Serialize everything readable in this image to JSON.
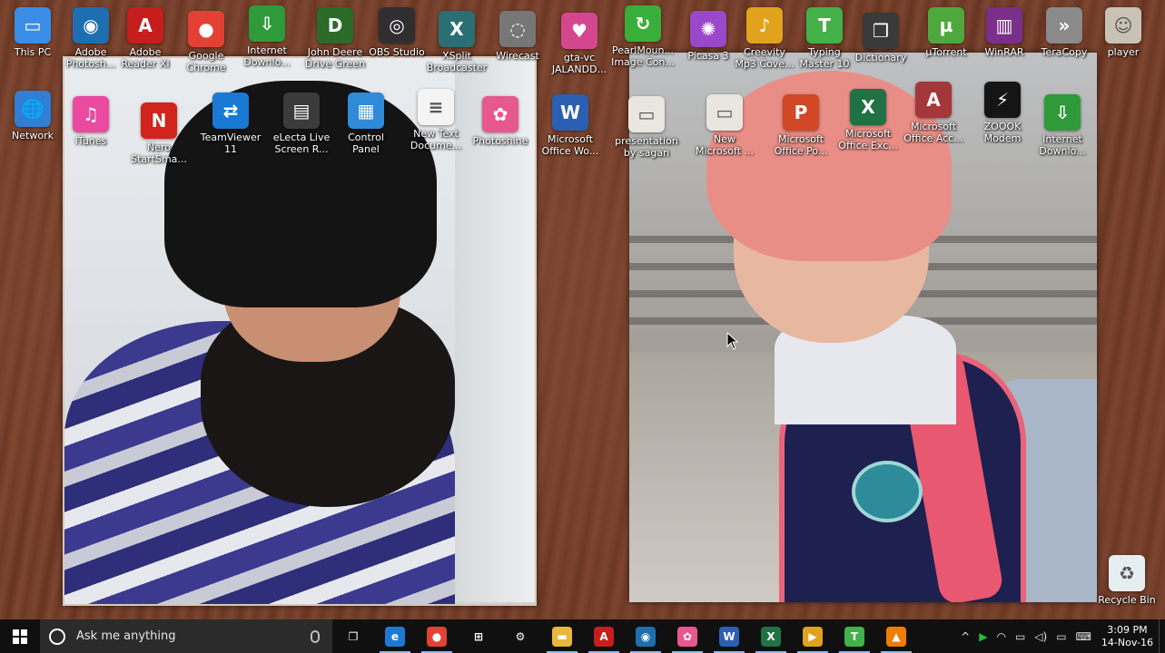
{
  "desktop": {
    "icons": [
      {
        "label": "This PC",
        "glyph": "▭",
        "color": "#3a8ee6",
        "icon": "computer-icon"
      },
      {
        "label": "Network",
        "glyph": "🌐",
        "color": "#2f7fd6",
        "icon": "network-icon"
      },
      {
        "label": "Adobe\nPhotosh...",
        "glyph": "◉",
        "color": "#1d6fb0",
        "icon": "adobe-photoshop-icon"
      },
      {
        "label": "iTunes",
        "glyph": "♫",
        "color": "#ea4aa0",
        "icon": "itunes-icon"
      },
      {
        "label": "Adobe\nReader XI",
        "glyph": "A",
        "color": "#c61d1d",
        "icon": "adobe-reader-icon"
      },
      {
        "label": "Nero\nStartSma...",
        "glyph": "N",
        "color": "#d2231d",
        "icon": "nero-icon"
      },
      {
        "label": "Google\nChrome",
        "glyph": "●",
        "color": "#e34133",
        "icon": "chrome-icon"
      },
      {
        "label": "TeamViewer\n11",
        "glyph": "⇄",
        "color": "#1979d4",
        "icon": "teamviewer-icon"
      },
      {
        "label": "Internet\nDownlo...",
        "glyph": "⇩",
        "color": "#2e9a3a",
        "icon": "idm-icon"
      },
      {
        "label": "eLecta Live\nScreen R...",
        "glyph": "▤",
        "color": "#3b3b3b",
        "icon": "electa-icon"
      },
      {
        "label": "John Deere\nDrive Green",
        "glyph": "D",
        "color": "#2a6b2a",
        "icon": "john-deere-icon"
      },
      {
        "label": "Control\nPanel",
        "glyph": "▦",
        "color": "#2f8ad8",
        "icon": "control-panel-icon"
      },
      {
        "label": "OBS Studio",
        "glyph": "◎",
        "color": "#302e31",
        "icon": "obs-icon"
      },
      {
        "label": "New Text\nDocume...",
        "glyph": "≡",
        "color": "#f4f4f4",
        "icon": "text-document-icon"
      },
      {
        "label": "XSplit\nBroadcaster",
        "glyph": "X",
        "color": "#2a6f73",
        "icon": "xsplit-icon"
      },
      {
        "label": "Photoshine",
        "glyph": "✿",
        "color": "#e6588f",
        "icon": "photoshine-icon"
      },
      {
        "label": "Wirecast",
        "glyph": "◌",
        "color": "#777777",
        "icon": "wirecast-icon"
      },
      {
        "label": "gta-vc\nJALANDD...",
        "glyph": "♥",
        "color": "#d4478f",
        "icon": "gta-icon"
      },
      {
        "label": "Microsoft\nOffice Wo...",
        "glyph": "W",
        "color": "#2b5fb3",
        "icon": "word-icon"
      },
      {
        "label": "PearlMoun...\nImage Con...",
        "glyph": "↻",
        "color": "#3aae3a",
        "icon": "pearlmountain-icon"
      },
      {
        "label": "presentation\nby sagan",
        "glyph": "▭",
        "color": "#e9e5df",
        "icon": "presentation-file-icon"
      },
      {
        "label": "Picasa 3",
        "glyph": "✺",
        "color": "#9a48c9",
        "icon": "picasa-icon"
      },
      {
        "label": "New\nMicrosoft ...",
        "glyph": "▭",
        "color": "#e9e5df",
        "icon": "new-presentation-icon"
      },
      {
        "label": "Creevity\nMp3 Cove...",
        "glyph": "♪",
        "color": "#e1a21d",
        "icon": "creevity-icon"
      },
      {
        "label": "Microsoft\nOffice Po...",
        "glyph": "P",
        "color": "#d24726",
        "icon": "powerpoint-icon"
      },
      {
        "label": "Typing\nMaster 10",
        "glyph": "T",
        "color": "#43b049",
        "icon": "typing-master-icon"
      },
      {
        "label": "Microsoft\nOffice Exc...",
        "glyph": "X",
        "color": "#207245",
        "icon": "excel-icon"
      },
      {
        "label": "Dictionary",
        "glyph": "❒",
        "color": "#3a3a3a",
        "icon": "dictionary-icon"
      },
      {
        "label": "Microsoft\nOffice Acc...",
        "glyph": "A",
        "color": "#a4373a",
        "icon": "access-icon"
      },
      {
        "label": "µTorrent",
        "glyph": "µ",
        "color": "#4fa83d",
        "icon": "utorrent-icon"
      },
      {
        "label": "ZOOOK\nModem",
        "glyph": "⚡",
        "color": "#151515",
        "icon": "zoook-modem-icon"
      },
      {
        "label": "WinRAR",
        "glyph": "▥",
        "color": "#7a2f8a",
        "icon": "winrar-icon"
      },
      {
        "label": "Internet\nDownlo...",
        "glyph": "⇩",
        "color": "#2e9a3a",
        "icon": "idm-icon-2"
      },
      {
        "label": "TeraCopy",
        "glyph": "»",
        "color": "#8a8a8a",
        "icon": "teracopy-icon"
      },
      {
        "label": "player",
        "glyph": "☺",
        "color": "#c9c1b3",
        "icon": "player-icon"
      },
      {
        "label": "Recycle Bin",
        "glyph": "♻",
        "color": "#e7eef2",
        "icon": "recycle-bin-icon"
      }
    ]
  },
  "taskbar": {
    "search_placeholder": "Ask me anything",
    "apps": [
      {
        "name": "task-view",
        "glyph": "❐",
        "color": "#101010",
        "icon": "task-view-icon"
      },
      {
        "name": "edge",
        "glyph": "e",
        "color": "#1e79d6",
        "icon": "edge-icon"
      },
      {
        "name": "chrome",
        "glyph": "●",
        "color": "#e34133",
        "icon": "chrome-icon"
      },
      {
        "name": "store",
        "glyph": "⊞",
        "color": "#101010",
        "icon": "store-icon"
      },
      {
        "name": "settings",
        "glyph": "⚙",
        "color": "#101010",
        "icon": "settings-icon"
      },
      {
        "name": "file-explorer",
        "glyph": "▬",
        "color": "#e8b73c",
        "icon": "folder-icon"
      },
      {
        "name": "adobe-reader",
        "glyph": "A",
        "color": "#c61d1d",
        "icon": "adobe-reader-icon"
      },
      {
        "name": "photoshop",
        "glyph": "◉",
        "color": "#1d6fb0",
        "icon": "adobe-photoshop-icon"
      },
      {
        "name": "photoshine",
        "glyph": "✿",
        "color": "#e6588f",
        "icon": "photoshine-icon"
      },
      {
        "name": "word",
        "glyph": "W",
        "color": "#2b5fb3",
        "icon": "word-icon"
      },
      {
        "name": "excel",
        "glyph": "X",
        "color": "#207245",
        "icon": "excel-icon"
      },
      {
        "name": "media-player",
        "glyph": "▶",
        "color": "#e0a21d",
        "icon": "media-player-icon"
      },
      {
        "name": "typing-master",
        "glyph": "T",
        "color": "#43b049",
        "icon": "typing-master-icon"
      },
      {
        "name": "vlc",
        "glyph": "▲",
        "color": "#ef7d00",
        "icon": "vlc-icon"
      }
    ],
    "tray": {
      "chevron": "^",
      "time": "3:09 PM",
      "date": "14-Nov-16"
    }
  }
}
